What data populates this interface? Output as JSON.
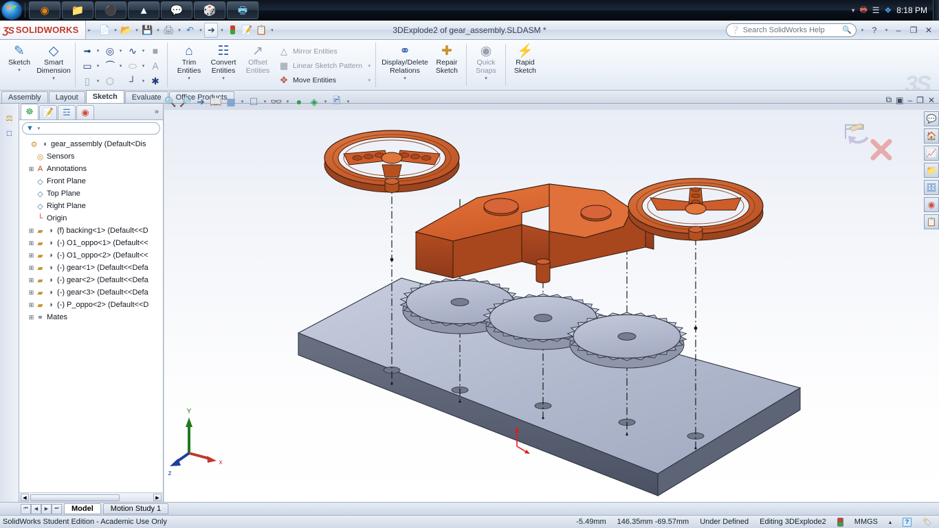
{
  "taskbar": {
    "start_label": "Start",
    "items": [
      {
        "name": "firefox",
        "glyph": "🦊"
      },
      {
        "name": "file-explorer",
        "glyph": "📁"
      },
      {
        "name": "steam",
        "glyph": "⚫"
      },
      {
        "name": "foxit",
        "glyph": "🦊"
      },
      {
        "name": "messenger",
        "glyph": "💬"
      },
      {
        "name": "solidworks",
        "glyph": "🎲"
      },
      {
        "name": "window",
        "glyph": "🖼"
      }
    ],
    "tray": {
      "expand": "▾",
      "icons": [
        "printer-icon",
        "signal-icon",
        "dropbox-icon"
      ],
      "clock": "8:18 PM"
    }
  },
  "titlebar": {
    "brand_ds": "ƷS",
    "brand_name": "SOLIDWORKS",
    "document_title": "3DExplode2 of gear_assembly.SLDASM *",
    "quick_access": [
      {
        "label": "New",
        "icon": "new-document-icon"
      },
      {
        "label": "Open",
        "icon": "open-folder-icon"
      },
      {
        "label": "Save",
        "icon": "save-icon"
      },
      {
        "label": "Print",
        "icon": "print-icon"
      },
      {
        "label": "Undo",
        "icon": "undo-icon"
      },
      {
        "label": "Select",
        "icon": "select-arrow-icon"
      },
      {
        "label": "Rebuild",
        "icon": "traffic-light-icon"
      },
      {
        "label": "Options",
        "icon": "options-icon"
      },
      {
        "label": "Settings",
        "icon": "settings-list-icon"
      }
    ],
    "search_placeholder": "Search SolidWorks Help",
    "help_label": "?",
    "minimize": "–",
    "restore": "❐",
    "close": "✕"
  },
  "ribbon": {
    "buttons": [
      {
        "label_line1": "Sketch",
        "label_line2": "",
        "icon": "sketch-icon",
        "has_dropdown": true
      },
      {
        "label_line1": "Smart",
        "label_line2": "Dimension",
        "icon": "smart-dimension-icon",
        "has_dropdown": true
      }
    ],
    "sketch_tools": [
      {
        "name": "line-tool",
        "glyph": "╲",
        "dim": false,
        "dropdown": true
      },
      {
        "name": "circle-tool",
        "glyph": "◎",
        "dim": false,
        "dropdown": true
      },
      {
        "name": "spline-tool",
        "glyph": "∿",
        "dim": false,
        "dropdown": true
      },
      {
        "name": "sketch-pattern-tool",
        "glyph": "░",
        "dim": true,
        "dropdown": false
      },
      {
        "name": "rectangle-tool",
        "glyph": "▭",
        "dim": false,
        "dropdown": true
      },
      {
        "name": "arc-tool",
        "glyph": "◜",
        "dim": false,
        "dropdown": true
      },
      {
        "name": "ellipse-tool",
        "glyph": "⬭",
        "dim": true,
        "dropdown": true
      },
      {
        "name": "text-tool",
        "glyph": "A",
        "dim": true,
        "dropdown": false
      },
      {
        "name": "slot-tool",
        "glyph": "▬",
        "dim": true,
        "dropdown": true
      },
      {
        "name": "polygon-tool",
        "glyph": "⬡",
        "dim": true,
        "dropdown": false
      },
      {
        "name": "fillet-tool",
        "glyph": "┐",
        "dim": false,
        "dropdown": true
      },
      {
        "name": "point-tool",
        "glyph": "✳",
        "dim": false,
        "dropdown": false
      }
    ],
    "entity_buttons": [
      {
        "label_line1": "Trim",
        "label_line2": "Entities",
        "icon": "trim-entities-icon",
        "has_dropdown": true,
        "dim": false
      },
      {
        "label_line1": "Convert",
        "label_line2": "Entities",
        "icon": "convert-entities-icon",
        "has_dropdown": true,
        "dim": false
      },
      {
        "label_line1": "Offset",
        "label_line2": "Entities",
        "icon": "offset-entities-icon",
        "has_dropdown": false,
        "dim": true
      }
    ],
    "list_items": [
      {
        "label": "Mirror Entities",
        "icon": "mirror-entities-icon",
        "has_dropdown": false
      },
      {
        "label": "Linear Sketch Pattern",
        "icon": "linear-pattern-icon",
        "has_dropdown": true
      },
      {
        "label": "Move Entities",
        "icon": "move-entities-icon",
        "has_dropdown": true
      }
    ],
    "right_buttons": [
      {
        "label_line1": "Display/Delete",
        "label_line2": "Relations",
        "icon": "display-delete-relations-icon",
        "has_dropdown": true,
        "dim": false
      },
      {
        "label_line1": "Repair",
        "label_line2": "Sketch",
        "icon": "repair-sketch-icon",
        "has_dropdown": false,
        "dim": false
      },
      {
        "label_line1": "Quick",
        "label_line2": "Snaps",
        "icon": "quick-snaps-icon",
        "has_dropdown": true,
        "dim": true
      },
      {
        "label_line1": "Rapid",
        "label_line2": "Sketch",
        "icon": "rapid-sketch-icon",
        "has_dropdown": false,
        "dim": false
      }
    ],
    "watermark": "3S"
  },
  "tabs": [
    {
      "label": "Assembly",
      "active": false
    },
    {
      "label": "Layout",
      "active": false
    },
    {
      "label": "Sketch",
      "active": true
    },
    {
      "label": "Evaluate",
      "active": false
    },
    {
      "label": "Office Products",
      "active": false
    }
  ],
  "viewbar": [
    {
      "name": "zoom-to-fit-icon",
      "glyph": "🔍",
      "dropdown": false
    },
    {
      "name": "zoom-area-icon",
      "glyph": "🔎",
      "dropdown": false
    },
    {
      "name": "previous-view-icon",
      "glyph": "➶",
      "dropdown": false
    },
    {
      "name": "section-view-icon",
      "glyph": "📒",
      "dropdown": false
    },
    {
      "name": "view-orientation-icon",
      "glyph": "📦",
      "dropdown": true
    },
    {
      "name": "display-style-icon",
      "glyph": "⬜",
      "dropdown": true
    },
    {
      "name": "hide-show-icon",
      "glyph": "👓",
      "dropdown": true
    },
    {
      "name": "apply-scene-icon",
      "glyph": "🌈",
      "dropdown": false
    },
    {
      "name": "view-settings-icon",
      "glyph": "🎨",
      "dropdown": true
    },
    {
      "name": "display-manager-icon",
      "glyph": "🖼",
      "dropdown": true
    }
  ],
  "window_controls": {
    "restore_sub": "⧉",
    "tile": "▣",
    "minimize": "–",
    "maximize": "❐",
    "close": "✕"
  },
  "left_rail": [
    {
      "name": "sketch-plane-icon",
      "glyph": "⚙"
    },
    {
      "name": "step-icon",
      "glyph": "⎯"
    }
  ],
  "panel": {
    "tabs": [
      {
        "name": "feature-manager-tab",
        "glyph": "🌿",
        "active": true
      },
      {
        "name": "property-manager-tab",
        "glyph": "📝",
        "active": false
      },
      {
        "name": "configuration-manager-tab",
        "glyph": "📊",
        "active": false
      },
      {
        "name": "display-manager-tab",
        "glyph": "🎨",
        "active": false
      }
    ],
    "more_glyph": "»",
    "filter_icon": "▼",
    "filter_placeholder": "",
    "tree": [
      {
        "depth": 0,
        "expander": "",
        "icon1": "assembly-icon",
        "icon2": "glasses-icon",
        "label": "gear_assembly  (Default<Dis"
      },
      {
        "depth": 1,
        "expander": "",
        "icon1": "sensors-icon",
        "icon2": "",
        "label": "Sensors"
      },
      {
        "depth": 1,
        "expander": "+",
        "icon1": "annotations-icon",
        "icon2": "",
        "label": "Annotations"
      },
      {
        "depth": 1,
        "expander": "",
        "icon1": "plane-icon",
        "icon2": "",
        "label": "Front Plane"
      },
      {
        "depth": 1,
        "expander": "",
        "icon1": "plane-icon",
        "icon2": "",
        "label": "Top Plane"
      },
      {
        "depth": 1,
        "expander": "",
        "icon1": "plane-icon",
        "icon2": "",
        "label": "Right Plane"
      },
      {
        "depth": 1,
        "expander": "",
        "icon1": "origin-icon",
        "icon2": "",
        "label": "Origin"
      },
      {
        "depth": 1,
        "expander": "+",
        "icon1": "part-icon",
        "icon2": "glasses-icon",
        "label": "(f) backing<1> (Default<<D"
      },
      {
        "depth": 1,
        "expander": "+",
        "icon1": "part-icon",
        "icon2": "glasses-icon",
        "label": "(-) O1_oppo<1> (Default<<"
      },
      {
        "depth": 1,
        "expander": "+",
        "icon1": "part-icon",
        "icon2": "glasses-icon",
        "label": "(-) O1_oppo<2> (Default<<"
      },
      {
        "depth": 1,
        "expander": "+",
        "icon1": "part-icon",
        "icon2": "glasses-icon",
        "label": "(-) gear<1> (Default<<Defa"
      },
      {
        "depth": 1,
        "expander": "+",
        "icon1": "part-icon",
        "icon2": "glasses-icon",
        "label": "(-) gear<2> (Default<<Defa"
      },
      {
        "depth": 1,
        "expander": "+",
        "icon1": "part-icon",
        "icon2": "glasses-icon",
        "label": "(-) gear<3> (Default<<Defa"
      },
      {
        "depth": 1,
        "expander": "+",
        "icon1": "part-icon",
        "icon2": "glasses-icon",
        "label": "(-) P_oppo<2> (Default<<D"
      },
      {
        "depth": 1,
        "expander": "+",
        "icon1": "mates-icon",
        "icon2": "",
        "label": "Mates"
      }
    ]
  },
  "graphics": {
    "triad": {
      "x_label": "x",
      "y_label": "Y",
      "z_label": "z"
    },
    "colors": {
      "part_orange": "#d2602c",
      "part_orange_dark": "#9c4520",
      "gear_gray": "#b6bdd0",
      "plate_gray": "#aab3c9",
      "plate_edge": "#555c6b",
      "explode_line": "#1a1a1a",
      "origin_red": "#e01b1b"
    },
    "sketch_confirm": {
      "exit_sketch": "exit-sketch-icon",
      "cancel": "cancel-sketch-icon"
    }
  },
  "task_pane": [
    {
      "name": "solidworks-resources-icon",
      "glyph": "💬"
    },
    {
      "name": "design-library-icon",
      "glyph": "🏠"
    },
    {
      "name": "file-explorer-icon",
      "glyph": "📈"
    },
    {
      "name": "search-folder-icon",
      "glyph": "📂"
    },
    {
      "name": "view-palette-icon",
      "glyph": "🗂"
    },
    {
      "name": "appearances-icon",
      "glyph": "🎨"
    },
    {
      "name": "custom-properties-icon",
      "glyph": "📋"
    }
  ],
  "docbar": {
    "nav": [
      "⏮",
      "◀",
      "▶",
      "⏭"
    ],
    "tabs": [
      {
        "label": "Model",
        "active": true
      },
      {
        "label": "Motion Study 1",
        "active": false
      }
    ]
  },
  "statusbar": {
    "left": "SolidWorks Student Edition - Academic Use Only",
    "coord_z": "-5.49mm",
    "coord_xy": "146.35mm  -69.57mm",
    "state": "Under Defined",
    "editing": "Editing 3DExplode2",
    "units": "MMGS",
    "units_caret": "▴",
    "help_badge": "?"
  }
}
